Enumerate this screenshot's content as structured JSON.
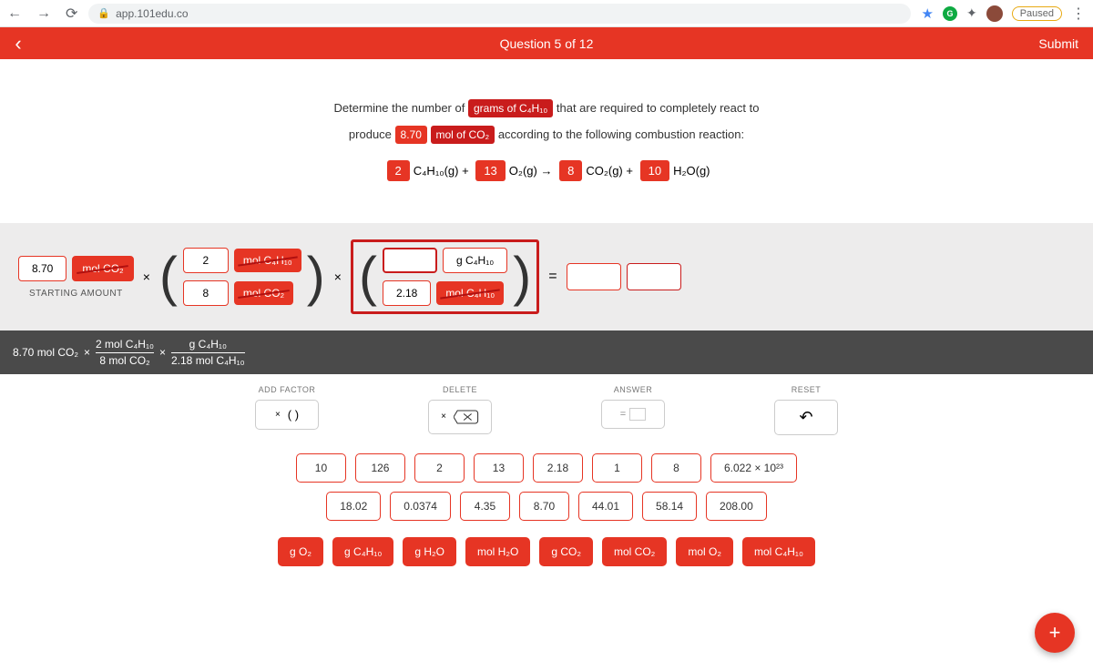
{
  "browser": {
    "url": "app.101edu.co",
    "paused": "Paused"
  },
  "header": {
    "title": "Question 5 of 12",
    "submit": "Submit"
  },
  "prompt": {
    "p1a": "Determine the number of",
    "p1b": "grams of C₄H₁₀",
    "p1c": "that are required to completely react to",
    "p2a": "produce",
    "p2b": "8.70",
    "p2c": "mol of CO₂",
    "p2d": "according to the following combustion reaction:"
  },
  "equation": {
    "c1": "2",
    "s1": "C₄H₁₀(g) +",
    "c2": "13",
    "s2": "O₂(g) →",
    "c3": "8",
    "s3": "CO₂(g) +",
    "c4": "10",
    "s4": "H₂O(g)"
  },
  "work": {
    "start_val": "8.70",
    "start_unit": "mol CO₂",
    "start_label": "STARTING AMOUNT",
    "f1_top_val": "2",
    "f1_top_unit": "mol C₄H₁₀",
    "f1_bot_val": "8",
    "f1_bot_unit": "mol CO₂",
    "f2_top_unit": "g C₄H₁₀",
    "f2_bot_val": "2.18",
    "f2_bot_unit": "mol C₄H₁₀"
  },
  "sofar": {
    "start": "8.70 mol CO₂",
    "f1_top": "2 mol C₄H₁₀",
    "f1_bot": "8 mol CO₂",
    "f2_top": "g C₄H₁₀",
    "f2_bot": "2.18 mol C₄H₁₀"
  },
  "controls": {
    "add_label": "ADD FACTOR",
    "add_btn": "( )",
    "delete_label": "DELETE",
    "answer_label": "ANSWER",
    "reset_label": "RESET"
  },
  "tiles": {
    "nums": [
      "10",
      "126",
      "2",
      "13",
      "2.18",
      "1",
      "8",
      "6.022 × 10²³",
      "18.02",
      "0.0374",
      "4.35",
      "8.70",
      "44.01",
      "58.14",
      "208.00"
    ],
    "units": [
      "g O₂",
      "g C₄H₁₀",
      "g H₂O",
      "mol H₂O",
      "g CO₂",
      "mol CO₂",
      "mol O₂",
      "mol C₄H₁₀"
    ]
  }
}
